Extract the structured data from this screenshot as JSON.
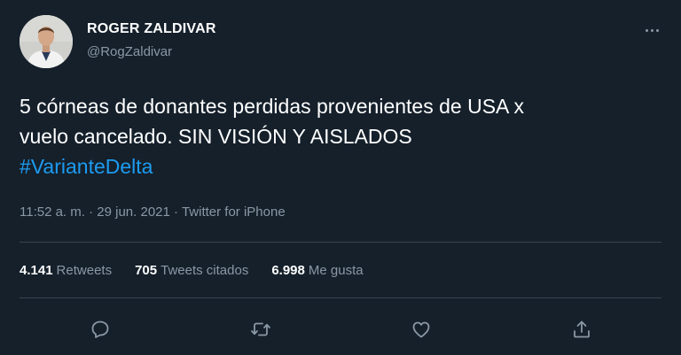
{
  "author": {
    "name": "ROGER ZALDIVAR",
    "handle": "@RogZaldivar"
  },
  "tweet": {
    "text_line1": "5 córneas de donantes perdidas provenientes de USA x",
    "text_line2": "vuelo cancelado. SIN VISIÓN Y AISLADOS",
    "hashtag": "#VarianteDelta"
  },
  "meta": {
    "time": "11:52 a. m.",
    "separator1": "·",
    "date": "29 jun. 2021",
    "separator2": "·",
    "source": "Twitter for iPhone"
  },
  "stats": {
    "retweets_count": "4.141",
    "retweets_label": "Retweets",
    "quotes_count": "705",
    "quotes_label": "Tweets citados",
    "likes_count": "6.998",
    "likes_label": "Me gusta"
  },
  "actions": [
    "reply-icon",
    "retweet-icon",
    "like-icon",
    "share-icon"
  ],
  "colors": {
    "background": "#15202b",
    "text": "#ffffff",
    "secondary": "#8b98a5",
    "link": "#1d9bf0",
    "divider": "#38444d"
  }
}
